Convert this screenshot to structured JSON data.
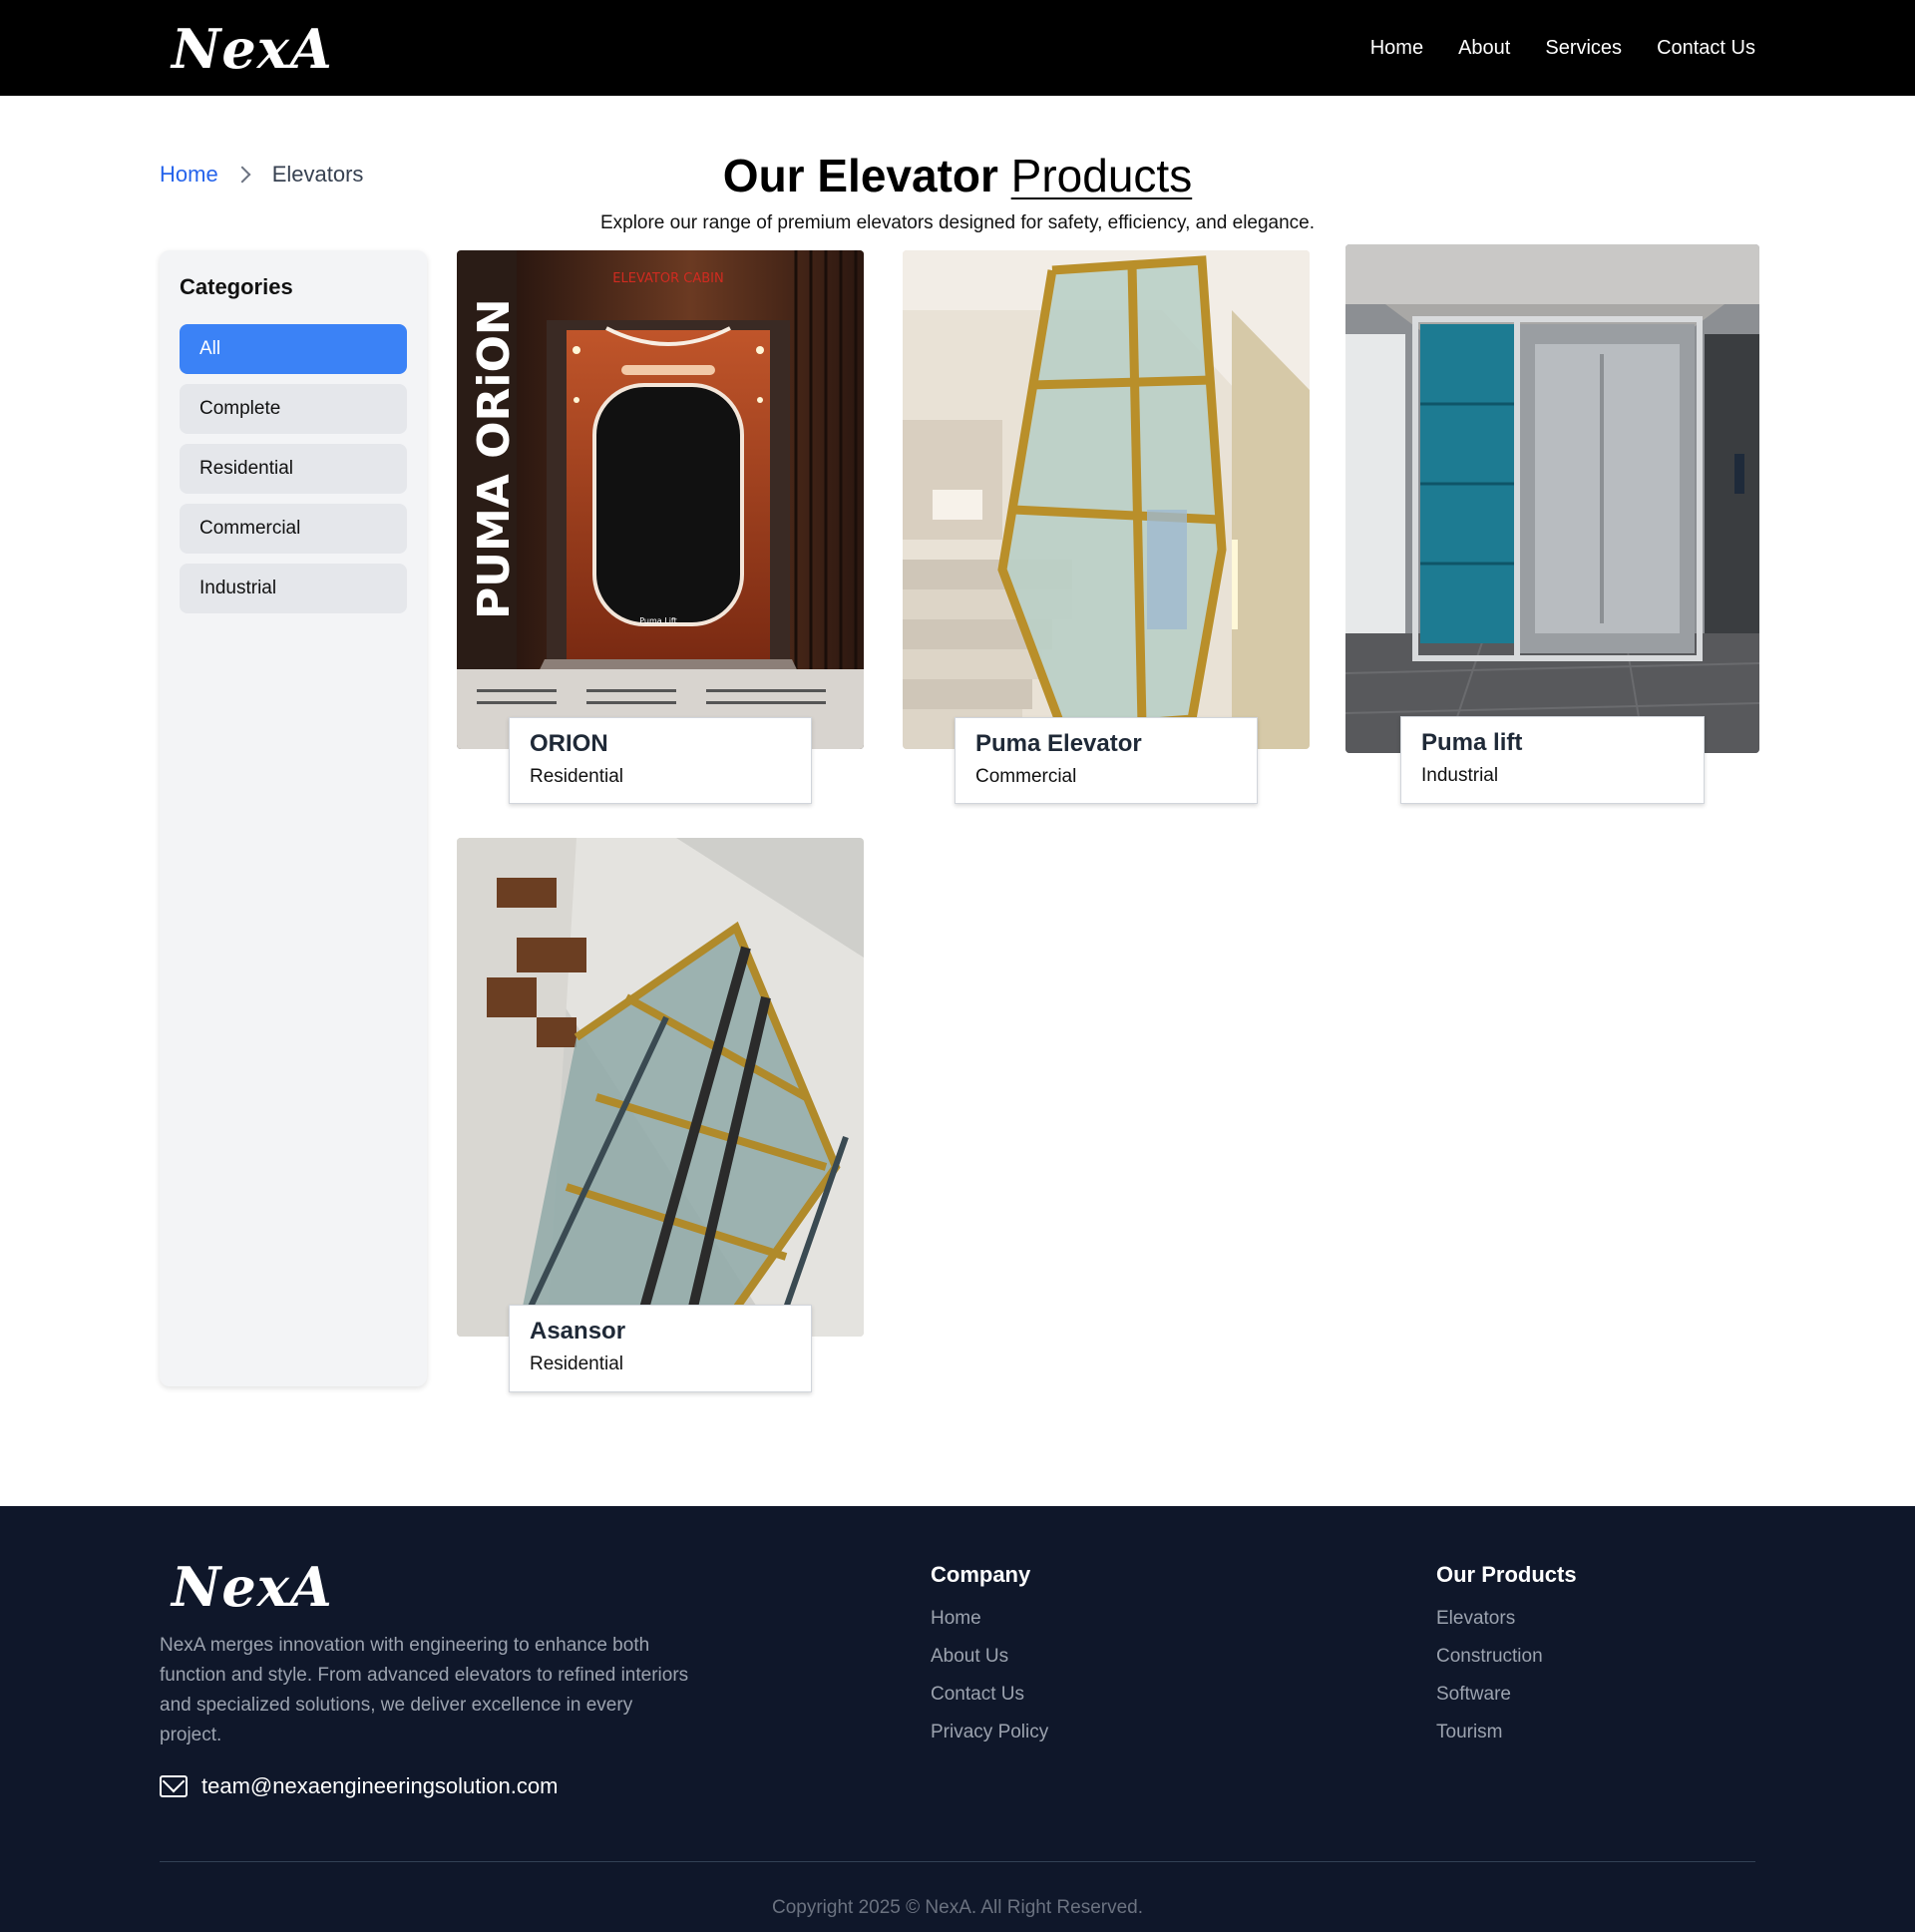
{
  "brand": {
    "logo_text": "NexA"
  },
  "nav": {
    "home": "Home",
    "about": "About",
    "services": "Services",
    "contact": "Contact Us"
  },
  "breadcrumb": {
    "home": "Home",
    "current": "Elevators"
  },
  "hero": {
    "title_bold": "Our Elevator",
    "title_light": "Products",
    "subtitle": "Explore our range of premium elevators designed for safety, efficiency, and elegance."
  },
  "sidebar": {
    "heading": "Categories",
    "categories": [
      "All",
      "Complete",
      "Residential",
      "Commercial",
      "Industrial"
    ],
    "selected": "All"
  },
  "products": [
    {
      "name": "ORION",
      "category": "Residential",
      "image_text": {
        "vertical": "PUMA ORiON",
        "sign": "ELEVATOR CABIN",
        "tag": "Puma Lift"
      }
    },
    {
      "name": "Puma Elevator",
      "category": "Commercial"
    },
    {
      "name": "Puma lift",
      "category": "Industrial"
    },
    {
      "name": "Asansor",
      "category": "Residential"
    }
  ],
  "footer": {
    "description": "NexA merges innovation with engineering to enhance both function and style. From advanced elevators to refined interiors and specialized solutions, we deliver excellence in every project.",
    "email": "team@nexaengineeringsolution.com",
    "company": {
      "heading": "Company",
      "links": [
        "Home",
        "About Us",
        "Contact Us",
        "Privacy Policy"
      ]
    },
    "products": {
      "heading": "Our Products",
      "links": [
        "Elevators",
        "Construction",
        "Software",
        "Tourism"
      ]
    },
    "copyright": "Copyright 2025 © NexA. All Right Reserved."
  },
  "colors": {
    "header_bg": "#000000",
    "accent": "#3b82f6",
    "footer_bg": "#0f172a",
    "chip_bg": "#e5e7eb"
  }
}
